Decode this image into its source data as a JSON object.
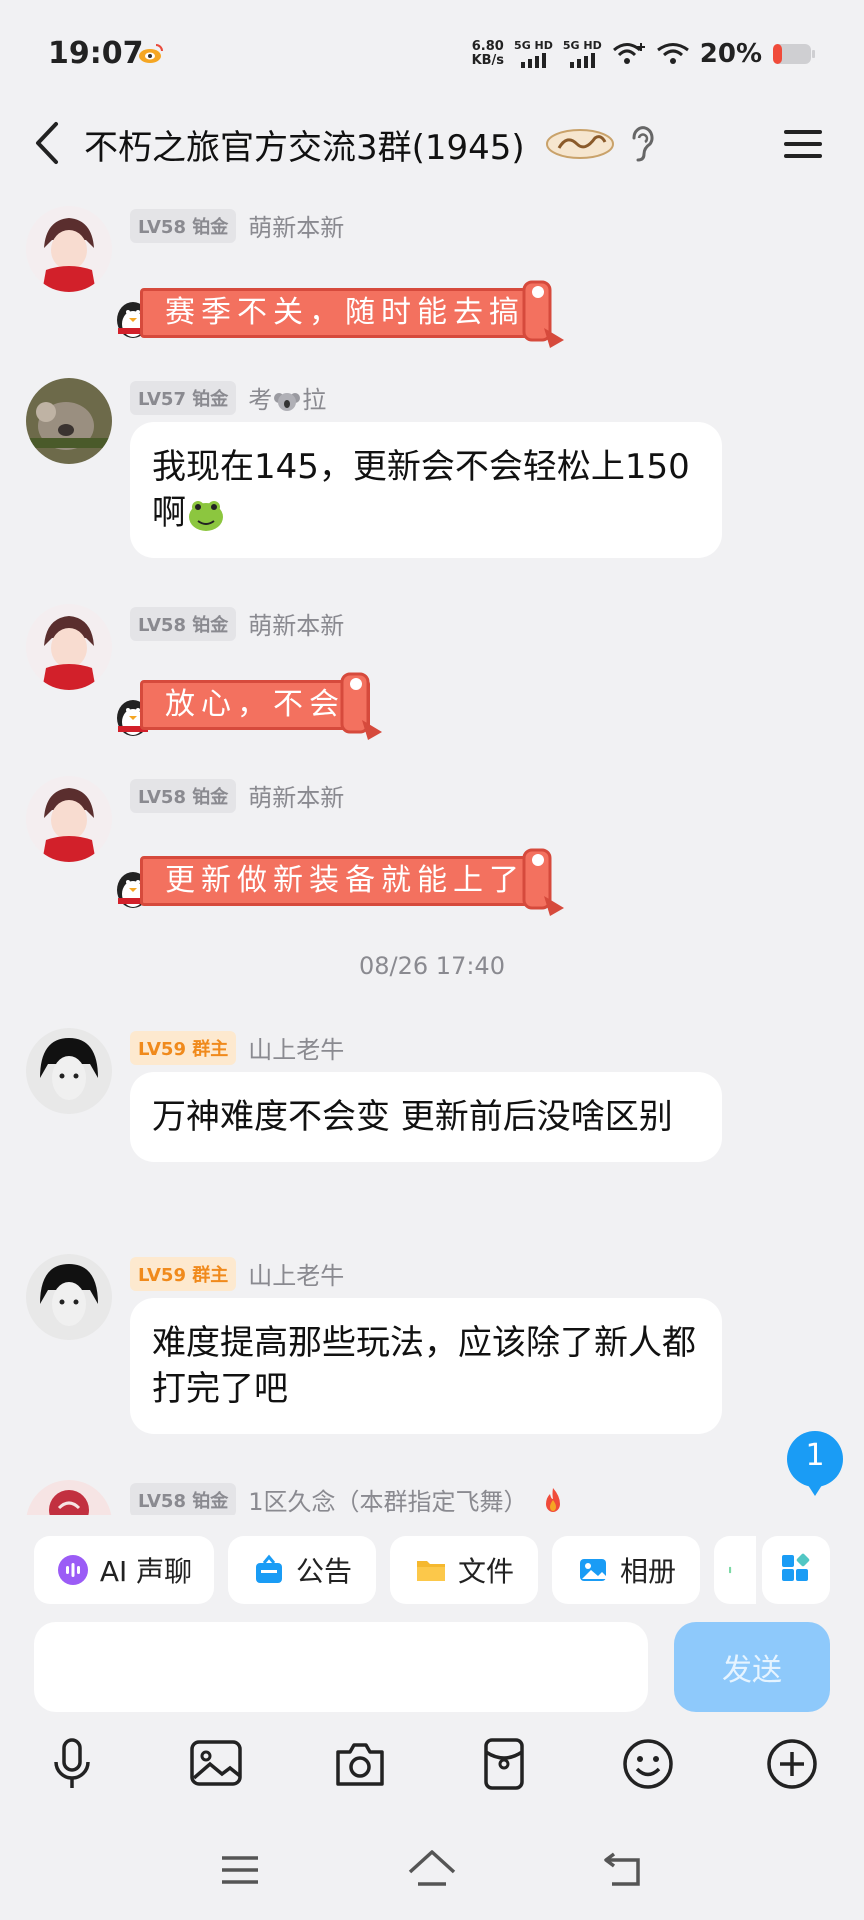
{
  "status": {
    "time": "19:07",
    "speed_value": "6.80",
    "speed_unit": "KB/s",
    "net1": "5G HD",
    "net2": "5G HD",
    "battery": "20%"
  },
  "header": {
    "title": "不朽之旅官方交流3群(1945)"
  },
  "messages": [
    {
      "level": "LV58 铂金",
      "nick": "萌新本新",
      "banner": "赛季不关，随时能去搞"
    },
    {
      "level": "LV57 铂金",
      "nick": "考",
      "nick_suffix": "拉",
      "text": "我现在145，更新会不会轻松上150啊"
    },
    {
      "level": "LV58 铂金",
      "nick": "萌新本新",
      "banner": "放心，不会"
    },
    {
      "level": "LV58 铂金",
      "nick": "萌新本新",
      "banner": "更新做新装备就能上了"
    },
    {
      "level": "LV59 群主",
      "nick": "山上老牛",
      "text": "万神难度不会变  更新前后没啥区别"
    },
    {
      "level": "LV59 群主",
      "nick": "山上老牛",
      "text": "难度提高那些玩法，应该除了新人都打完了吧"
    },
    {
      "level": "LV58 铂金",
      "nick": "1区久念（本群指定飞舞）"
    }
  ],
  "time_separator": "08/26 17:40",
  "unread_count": "1",
  "quickbar": {
    "ai_voice": "AI 声聊",
    "notice": "公告",
    "files": "文件",
    "album": "相册"
  },
  "input": {
    "send_label": "发送"
  },
  "colors": {
    "accent": "#8ec9fb",
    "owner_badge": "#f08a1c",
    "banner": "#f3715f",
    "unread": "#1a9cf5"
  }
}
